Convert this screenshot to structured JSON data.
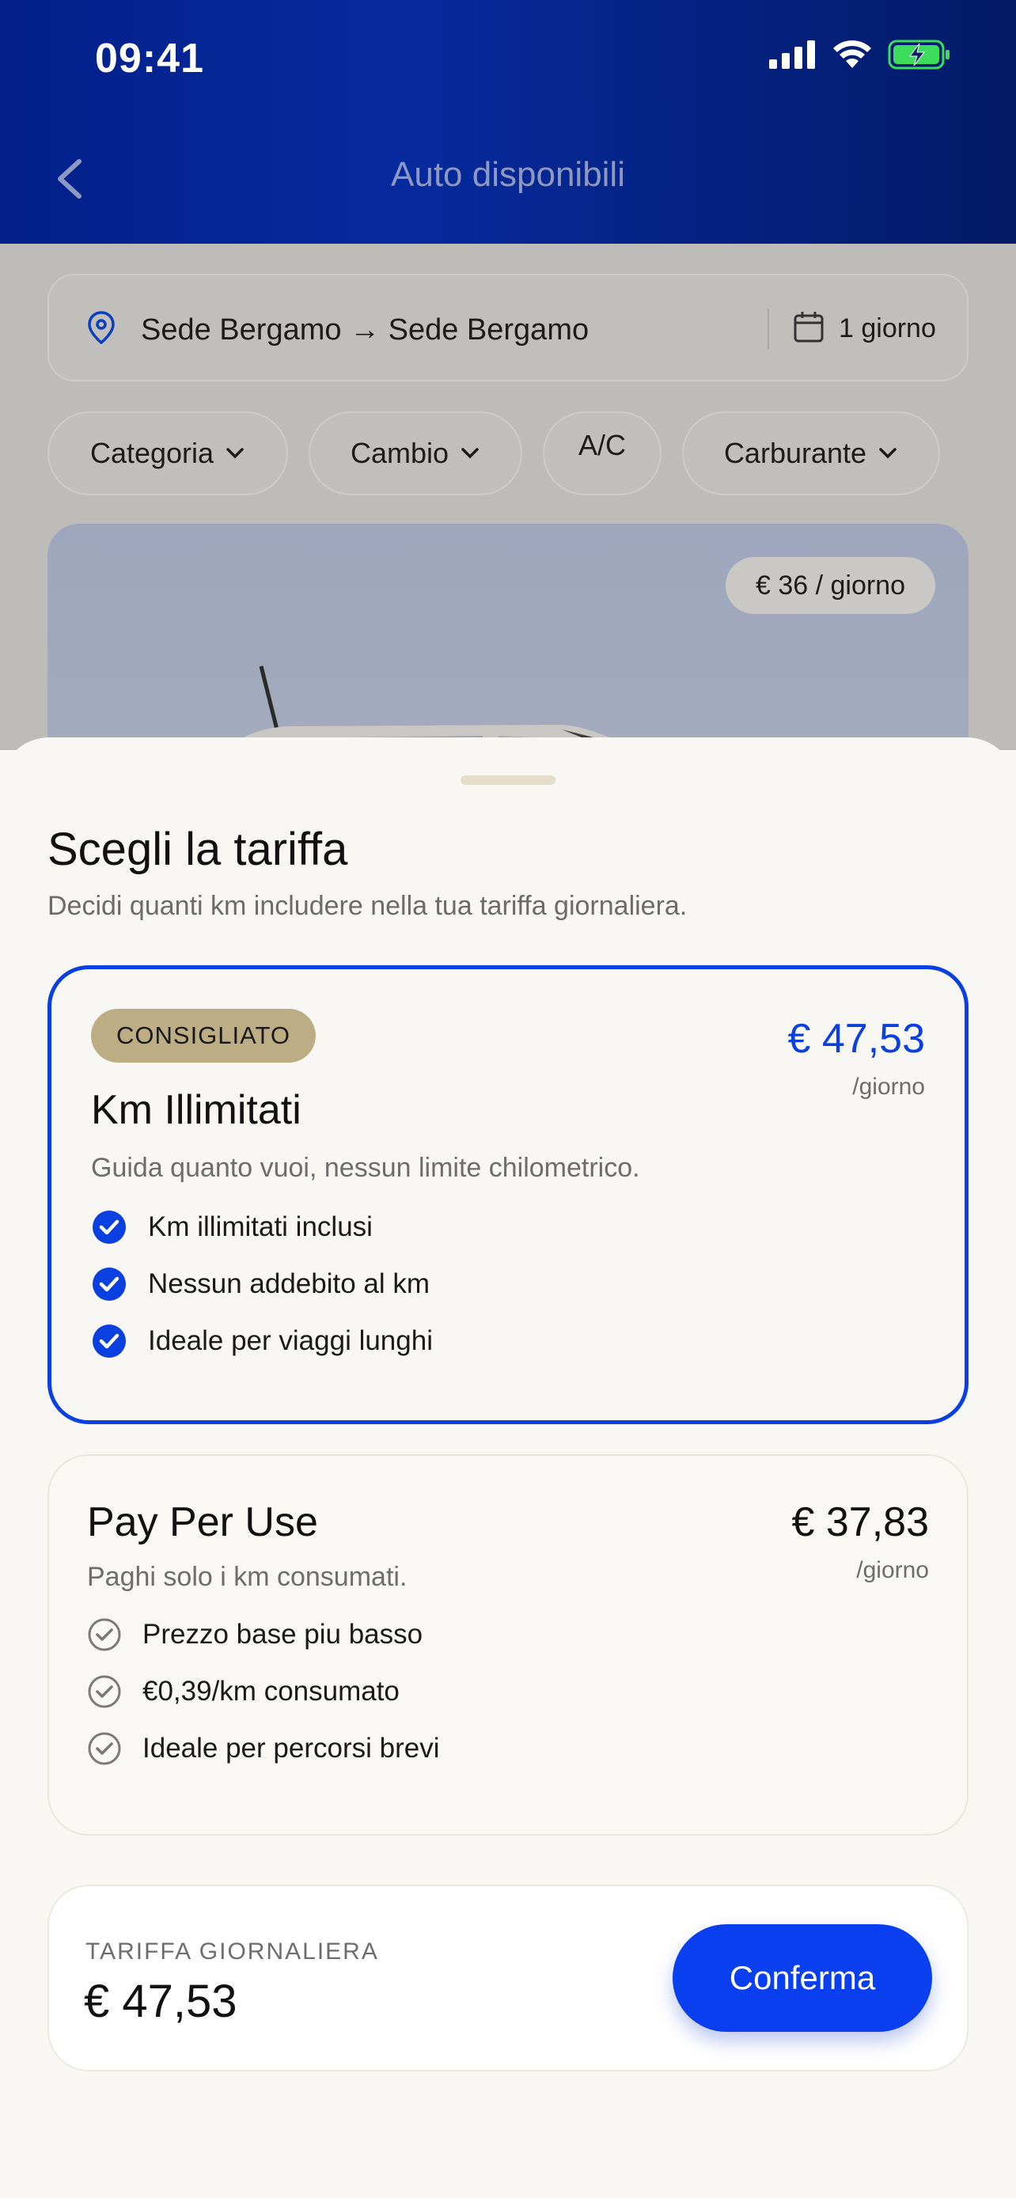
{
  "status_bar": {
    "time": "09:41"
  },
  "header": {
    "title": "Auto disponibili",
    "back_icon": "chevron-left-icon"
  },
  "search": {
    "route": "Sede Bergamo → Sede Bergamo",
    "duration": "1 giorno"
  },
  "filters": [
    {
      "label": "Categoria",
      "has_dropdown": true
    },
    {
      "label": "Cambio",
      "has_dropdown": true
    },
    {
      "label": "A/C",
      "has_dropdown": false
    },
    {
      "label": "Carburante",
      "has_dropdown": true
    }
  ],
  "car_card": {
    "price": "€ 36 / giorno"
  },
  "sheet": {
    "title": "Scegli la tariffa",
    "subtitle": "Decidi quanti km includere nella tua tariffa giornaliera."
  },
  "plans": [
    {
      "badge": "CONSIGLIATO",
      "name": "Km Illimitati",
      "description": "Guida quanto vuoi, nessun limite chilometrico.",
      "price": "€ 47,53",
      "per": "/giorno",
      "selected": true,
      "features": [
        "Km illimitati inclusi",
        "Nessun addebito al km",
        "Ideale per viaggi lunghi"
      ]
    },
    {
      "name": "Pay Per Use",
      "description": "Paghi solo i km consumati.",
      "price": "€ 37,83",
      "per": "/giorno",
      "selected": false,
      "features": [
        "Prezzo base piu basso",
        "€0,39/km consumato",
        "Ideale per percorsi brevi"
      ]
    }
  ],
  "summary": {
    "label": "TARIFFA GIORNALIERA",
    "value": "€ 47,53",
    "confirm_label": "Conferma"
  },
  "colors": {
    "primary": "#0a3ff0",
    "header_gradient": "#03208a",
    "badge": "#bcad85",
    "sheet_background": "#f8f7f4"
  }
}
